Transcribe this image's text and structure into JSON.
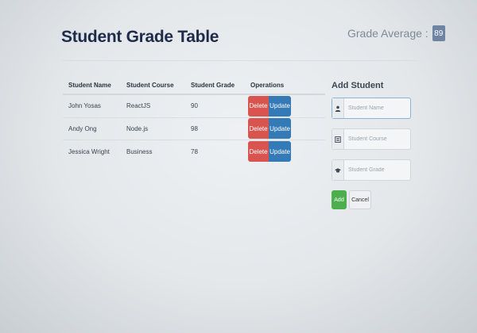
{
  "page": {
    "title": "Student Grade Table",
    "average_label": "Grade Average :",
    "average_value": "89"
  },
  "table": {
    "headers": [
      "Student Name",
      "Student Course",
      "Student Grade",
      "Operations"
    ],
    "rows": [
      {
        "name": "John Yosas",
        "course": "ReactJS",
        "grade": "90",
        "delete_label": "Delete",
        "update_label": "Update"
      },
      {
        "name": "Andy Ong",
        "course": "Node.js",
        "grade": "98",
        "delete_label": "Delete",
        "update_label": "Update"
      },
      {
        "name": "Jessica Wright",
        "course": "Business",
        "grade": "78",
        "delete_label": "Delete",
        "update_label": "Update"
      }
    ]
  },
  "form": {
    "title": "Add Student",
    "name_placeholder": "Student Name",
    "course_placeholder": "Student Course",
    "grade_placeholder": "Student Grade",
    "name_icon": "user-icon",
    "course_icon": "list-alt-icon",
    "grade_icon": "graduation-cap-icon",
    "add_label": "Add",
    "cancel_label": "Cancel"
  },
  "colors": {
    "delete": "#d9534f",
    "update": "#337ab7",
    "add": "#4cae4c",
    "badge": "#6f83a3"
  }
}
